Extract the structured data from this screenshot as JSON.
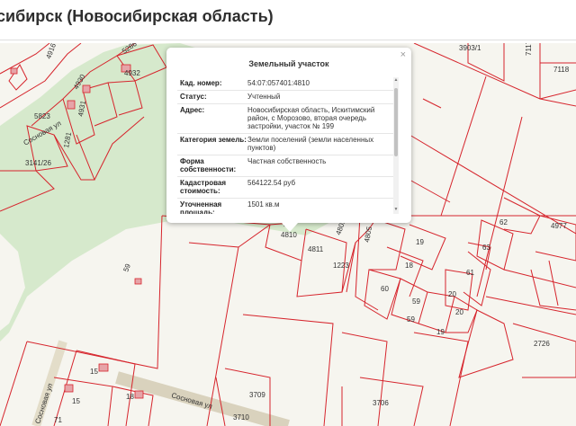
{
  "header": {
    "title": "сибирск (Новосибирская область)"
  },
  "popup": {
    "title": "Земельный участок",
    "close_glyph": "×",
    "rows": [
      {
        "key": "Кад. номер:",
        "value": "54:07:057401:4810"
      },
      {
        "key": "Статус:",
        "value": "Учтенный"
      },
      {
        "key": "Адрес:",
        "value": "Новосибирская область, Искитимский район, с Морозово, вторая очередь застройки, участок № 199"
      },
      {
        "key": "Категория земель:",
        "value": "Земли поселений (земли населенных пунктов)"
      },
      {
        "key": "Форма собственности:",
        "value": "Частная собственность"
      },
      {
        "key": "Кадастровая стоимость:",
        "value": "564122.54 руб"
      },
      {
        "key": "Уточненная площадь:",
        "value": "1501 кв.м"
      }
    ]
  },
  "map": {
    "parcel_labels": [
      "4916",
      "5286",
      "4932",
      "4930",
      "4931",
      "5823",
      "1281",
      "3141/26",
      "3903/1",
      "7117",
      "7118",
      "4810",
      "4811",
      "1223",
      "4805",
      "4805",
      "19",
      "18",
      "60",
      "59",
      "59",
      "19",
      "20",
      "20",
      "61",
      "63",
      "62",
      "4977",
      "2726",
      "3709",
      "3706",
      "3710",
      "15",
      "15",
      "18",
      "71",
      "59"
    ],
    "street_labels": [
      "Сосновая ул",
      "Сосновая ул",
      "Сосновая ул"
    ]
  }
}
